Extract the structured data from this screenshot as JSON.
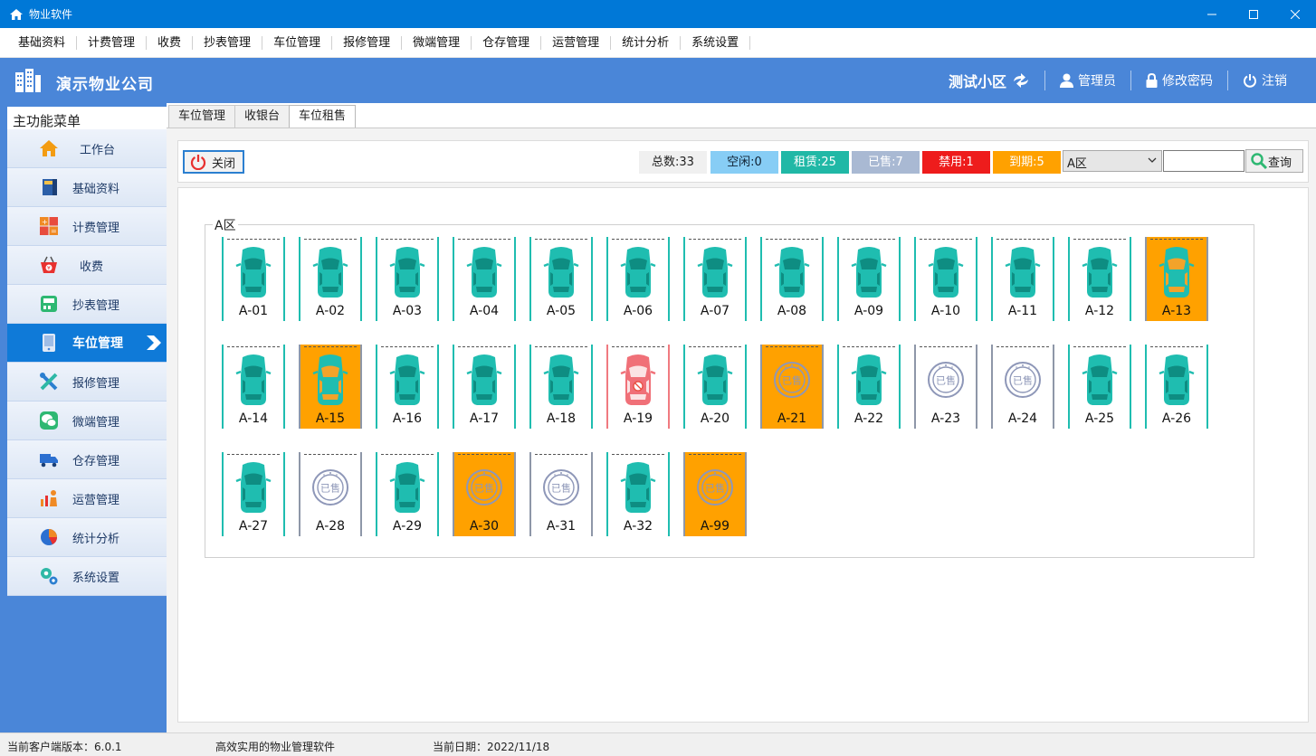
{
  "window": {
    "title": "物业软件"
  },
  "menubar": [
    "基础资料",
    "计费管理",
    "收费",
    "抄表管理",
    "车位管理",
    "报修管理",
    "微端管理",
    "仓存管理",
    "运营管理",
    "统计分析",
    "系统设置"
  ],
  "header": {
    "company": "演示物业公司",
    "community": "测试小区",
    "user": "管理员",
    "change_password": "修改密码",
    "logout": "注销"
  },
  "sidebar": {
    "title": "主功能菜单",
    "items": [
      {
        "label": "工作台",
        "icon": "home-icon"
      },
      {
        "label": "基础资料",
        "icon": "book-icon"
      },
      {
        "label": "计费管理",
        "icon": "calculator-icon"
      },
      {
        "label": "收费",
        "icon": "basket-icon"
      },
      {
        "label": "抄表管理",
        "icon": "meter-icon"
      },
      {
        "label": "车位管理",
        "icon": "parking-icon"
      },
      {
        "label": "报修管理",
        "icon": "tools-icon"
      },
      {
        "label": "微端管理",
        "icon": "wechat-icon"
      },
      {
        "label": "仓存管理",
        "icon": "truck-icon"
      },
      {
        "label": "运营管理",
        "icon": "people-chart-icon"
      },
      {
        "label": "统计分析",
        "icon": "pie-chart-icon"
      },
      {
        "label": "系统设置",
        "icon": "gears-icon"
      }
    ],
    "active_index": 5
  },
  "tabs": [
    "车位管理",
    "收银台",
    "车位租售"
  ],
  "active_tab": 2,
  "toolbar": {
    "close_label": "关闭",
    "stats": {
      "total": "总数:33",
      "idle": "空闲:0",
      "rent": "租赁:25",
      "sold": "已售:7",
      "ban": "禁用:1",
      "expire": "到期:5"
    },
    "zone_select": "A区",
    "search_value": "",
    "query_label": "查询"
  },
  "colors": {
    "rent": "#1fbdb0",
    "sold": "#a9b9d3",
    "ban": "#ee1c1c",
    "expire": "#ffa100",
    "idle": "#87cdf5",
    "accent": "#4a86d8"
  },
  "area": {
    "name": "A区",
    "slots": [
      {
        "id": "A-01",
        "status": "rent"
      },
      {
        "id": "A-02",
        "status": "rent"
      },
      {
        "id": "A-03",
        "status": "rent"
      },
      {
        "id": "A-04",
        "status": "rent"
      },
      {
        "id": "A-05",
        "status": "rent"
      },
      {
        "id": "A-06",
        "status": "rent"
      },
      {
        "id": "A-07",
        "status": "rent"
      },
      {
        "id": "A-08",
        "status": "rent"
      },
      {
        "id": "A-09",
        "status": "rent"
      },
      {
        "id": "A-10",
        "status": "rent"
      },
      {
        "id": "A-11",
        "status": "rent"
      },
      {
        "id": "A-12",
        "status": "rent"
      },
      {
        "id": "A-13",
        "status": "expire-rent"
      },
      {
        "id": "A-14",
        "status": "rent"
      },
      {
        "id": "A-15",
        "status": "expire-rent"
      },
      {
        "id": "A-16",
        "status": "rent"
      },
      {
        "id": "A-17",
        "status": "rent"
      },
      {
        "id": "A-18",
        "status": "rent"
      },
      {
        "id": "A-19",
        "status": "ban"
      },
      {
        "id": "A-20",
        "status": "rent"
      },
      {
        "id": "A-21",
        "status": "expire-sold"
      },
      {
        "id": "A-22",
        "status": "rent"
      },
      {
        "id": "A-23",
        "status": "sold"
      },
      {
        "id": "A-24",
        "status": "sold"
      },
      {
        "id": "A-25",
        "status": "rent"
      },
      {
        "id": "A-26",
        "status": "rent"
      },
      {
        "id": "A-27",
        "status": "rent"
      },
      {
        "id": "A-28",
        "status": "sold"
      },
      {
        "id": "A-29",
        "status": "rent"
      },
      {
        "id": "A-30",
        "status": "expire-sold"
      },
      {
        "id": "A-31",
        "status": "sold"
      },
      {
        "id": "A-32",
        "status": "rent"
      },
      {
        "id": "A-99",
        "status": "expire-sold"
      }
    ],
    "stamp_text": "已售"
  },
  "statusbar": {
    "version": "当前客户端版本：6.0.1",
    "slogan": "高效实用的物业管理软件",
    "date": "当前日期：2022/11/18"
  }
}
